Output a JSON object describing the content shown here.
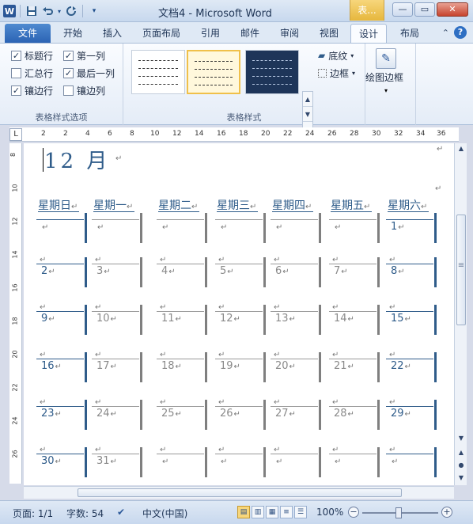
{
  "titlebar": {
    "title": "文档4  -  Microsoft Word",
    "context_tab": "表...",
    "qat": {
      "logo": "W",
      "save_icon": "save-icon",
      "undo_icon": "undo-icon",
      "redo_icon": "redo-icon"
    },
    "buttons": {
      "minimize": "—",
      "maximize": "▭",
      "close": "✕"
    }
  },
  "tabs": {
    "file": "文件",
    "items": [
      "开始",
      "插入",
      "页面布局",
      "引用",
      "邮件",
      "审阅",
      "视图",
      "设计",
      "布局"
    ],
    "active": "设计"
  },
  "ribbon": {
    "options_group": {
      "label": "表格样式选项",
      "checkboxes": [
        {
          "label": "标题行",
          "checked": true
        },
        {
          "label": "第一列",
          "checked": true
        },
        {
          "label": "汇总行",
          "checked": false
        },
        {
          "label": "最后一列",
          "checked": true
        },
        {
          "label": "镶边行",
          "checked": true
        },
        {
          "label": "镶边列",
          "checked": false
        }
      ]
    },
    "styles_group": {
      "label": "表格样式",
      "shading": "底纹",
      "borders": "边框"
    },
    "draw_group": {
      "label": "绘图边框"
    }
  },
  "ruler": {
    "numbers": [
      "2",
      "2",
      "4",
      "6",
      "8",
      "10",
      "12",
      "14",
      "16",
      "18",
      "20",
      "22",
      "24",
      "26",
      "28",
      "30",
      "32",
      "34",
      "36"
    ],
    "vertical": [
      "8",
      "10",
      "12",
      "14",
      "16",
      "18",
      "20",
      "22",
      "24",
      "26"
    ]
  },
  "document": {
    "month": "12 月",
    "para_mark": "↵",
    "days": [
      "星期日",
      "星期一",
      "星期二",
      "星期三",
      "星期四",
      "星期五",
      "星期六"
    ],
    "weeks": [
      [
        "",
        "",
        "",
        "",
        "",
        "",
        "1"
      ],
      [
        "2",
        "3",
        "4",
        "5",
        "6",
        "7",
        "8"
      ],
      [
        "9",
        "10",
        "11",
        "12",
        "13",
        "14",
        "15"
      ],
      [
        "16",
        "17",
        "18",
        "19",
        "20",
        "21",
        "22"
      ],
      [
        "23",
        "24",
        "25",
        "26",
        "27",
        "28",
        "29"
      ],
      [
        "30",
        "31",
        "",
        "",
        "",
        "",
        ""
      ]
    ]
  },
  "statusbar": {
    "page": "页面: 1/1",
    "words": "字数: 54",
    "lang": "中文(中国)",
    "zoom": "100%",
    "zoom_value": 100
  },
  "colors": {
    "accent_blue": "#2f5c8a",
    "file_tab": "#2b63b4",
    "context_tab": "#e6b73d"
  }
}
